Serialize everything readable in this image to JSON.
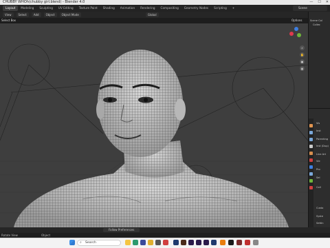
{
  "window": {
    "title": "CHUBBY WHOh(chubby girl.blend) - Blender 4.0",
    "minimize": "—",
    "maximize": "☐",
    "close": "✕"
  },
  "workspaces": [
    "Layout",
    "Modeling",
    "Sculpting",
    "UV Editing",
    "Texture Paint",
    "Shading",
    "Animation",
    "Rendering",
    "Compositing",
    "Geometry Nodes",
    "Scripting",
    "+"
  ],
  "active_workspace": "Layout",
  "scene": {
    "label": "Scene"
  },
  "viewport_header": {
    "mode": "Object Mode",
    "view": "View",
    "select": "Select",
    "add": "Add",
    "object": "Object",
    "transform": "Global",
    "options": "Options",
    "select_box": "Select Box"
  },
  "outliner": {
    "items": [
      "Scene Col",
      "Collec"
    ]
  },
  "properties": {
    "rows": [
      "Vis",
      "Inst",
      "Parenting",
      "Inst (Dup)",
      "Line Art",
      "Vie",
      "Pro",
      "Sel",
      "Coll",
      "Custo",
      "Syste",
      "Settin"
    ]
  },
  "viewport_footer": {
    "label": "Follow Preferences"
  },
  "statusbar": {
    "text": "Rotate View",
    "object": "Object"
  },
  "taskbar": {
    "search_placeholder": "Search",
    "icons": [
      "start-icon",
      "search-icon",
      "file-explorer-icon",
      "edge-icon",
      "chrome-icon",
      "photoshop-icon",
      "illustrator-icon",
      "after-effects-icon",
      "premiere-icon",
      "blender-icon",
      "media-encoder-icon",
      "acrobat-icon",
      "settings-icon"
    ]
  },
  "colors": {
    "viewport_bg": "#3e3e3e",
    "mesh_fill": "#c9c9c9",
    "wire": "#3a3a3a",
    "gizmo_x": "#e0394e",
    "gizmo_y": "#6fb53a",
    "gizmo_z": "#3f7fe0"
  }
}
